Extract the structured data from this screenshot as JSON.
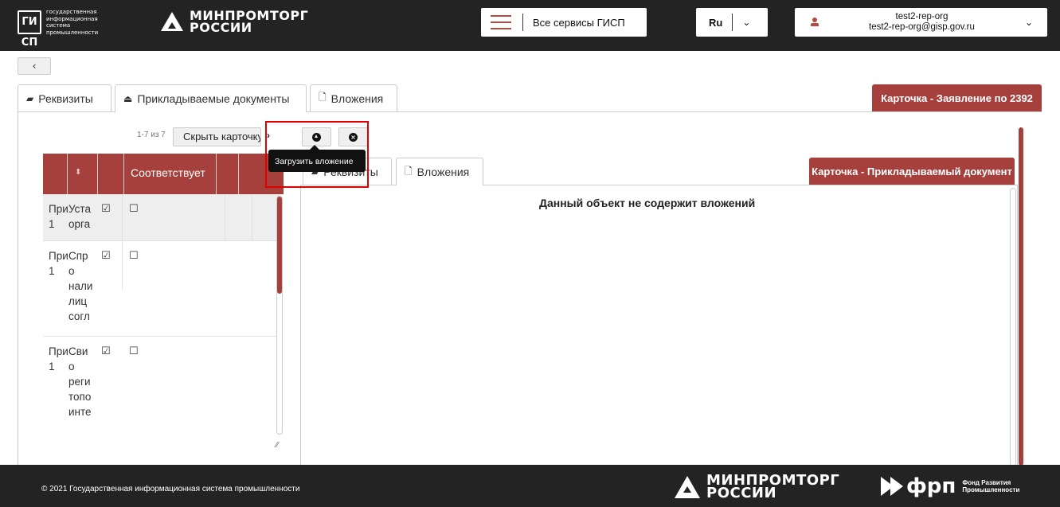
{
  "header": {
    "gisp_logo_mark": "ГИ СП",
    "gisp_logo_text": [
      "государственная",
      "информационная система",
      "промышленности"
    ],
    "ministry_logo_text": [
      "МИНПРОМТОРГ",
      "РОССИИ"
    ],
    "services_label": "Все сервисы ГИСП",
    "language": "Ru",
    "user_name": "test2-rep-org",
    "user_email": "test2-rep-org@gisp.gov.ru"
  },
  "tabs": [
    {
      "label": "Реквизиты",
      "icon": "book-icon"
    },
    {
      "label": "Прикладываемые документы",
      "icon": "inbox-icon"
    },
    {
      "label": "Вложения",
      "icon": "file-icon"
    }
  ],
  "card_title": "Карточка - Заявление по 2392",
  "list": {
    "pager": "1-7 из 7",
    "hide_card_label": "Скрыть карточку",
    "column_header": "Соответствует",
    "rows": [
      {
        "col1": [
          "При",
          "1"
        ],
        "col2": [
          "Уста",
          "орга"
        ],
        "checked": "☑",
        "unchecked": "☐"
      },
      {
        "col1": [
          "При",
          "1"
        ],
        "col2": [
          "Спр",
          "о",
          "нали",
          "лиц",
          "согл"
        ],
        "checked": "☑",
        "unchecked": "☐"
      },
      {
        "col1": [
          "При",
          "1"
        ],
        "col2": [
          "Сви",
          "о",
          "реги",
          "топо",
          "инте"
        ],
        "checked": "☑",
        "unchecked": "☐"
      }
    ]
  },
  "toolbar": {
    "tooltip": "Загрузить вложение"
  },
  "inner": {
    "tabs": [
      {
        "label": "Реквизиты",
        "icon": "book-icon"
      },
      {
        "label": "Вложения",
        "icon": "file-icon"
      }
    ],
    "card_title": "Карточка - Прикладываемый документ",
    "empty_message": "Данный объект не содержит вложений"
  },
  "footer": {
    "copyright": "© 2021 Государственная информационная система промышленности",
    "ministry_logo_text": [
      "МИНПРОМТОРГ",
      "РОССИИ"
    ],
    "frp_big": "фрп",
    "frp_small": [
      "Фонд Развития",
      "Промышленности"
    ]
  },
  "colors": {
    "header_bg": "#232323",
    "accent": "#a6403c",
    "highlight": "#e00000"
  }
}
